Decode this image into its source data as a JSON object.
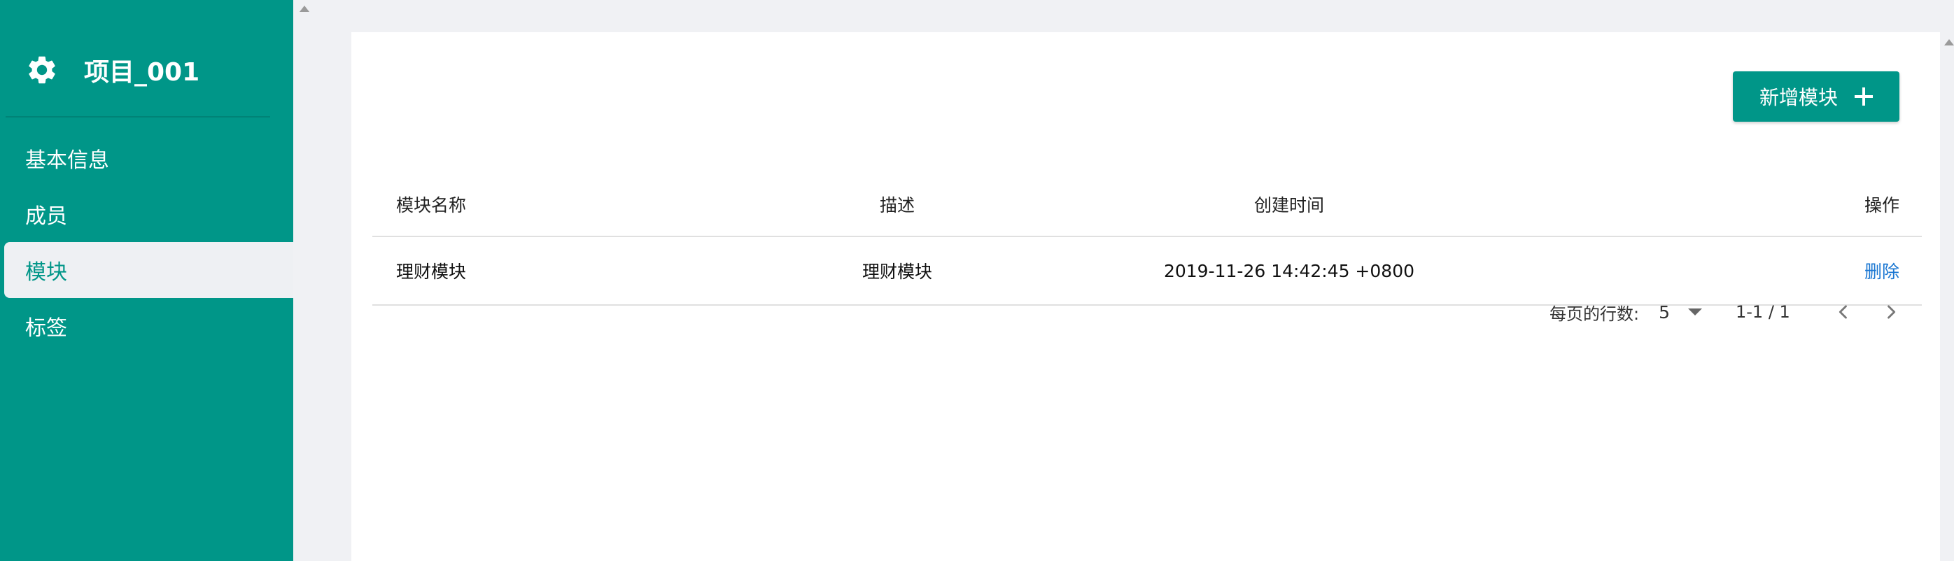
{
  "sidebar": {
    "title": "项目_001",
    "items": [
      {
        "label": "基本信息"
      },
      {
        "label": "成员"
      },
      {
        "label": "模块",
        "active": true
      },
      {
        "label": "标签"
      }
    ]
  },
  "toolbar": {
    "add_label": "新增模块"
  },
  "table": {
    "columns": [
      "模块名称",
      "描述",
      "创建时间",
      "操作"
    ],
    "rows": [
      {
        "name": "理财模块",
        "description": "理财模块",
        "created": "2019-11-26 14:42:45 +0800",
        "action": "删除"
      }
    ]
  },
  "pagination": {
    "rows_per_page_label": "每页的行数:",
    "rows_per_page": "5",
    "range": "1-1 / 1"
  },
  "colors": {
    "primary": "#009688",
    "link": "#1976d2",
    "background": "#f0f1f4"
  },
  "icons": {
    "header": "gear-icon",
    "add": "plus-icon",
    "rows_dropdown": "caret-down-icon",
    "prev": "chevron-left-icon",
    "next": "chevron-right-icon"
  }
}
